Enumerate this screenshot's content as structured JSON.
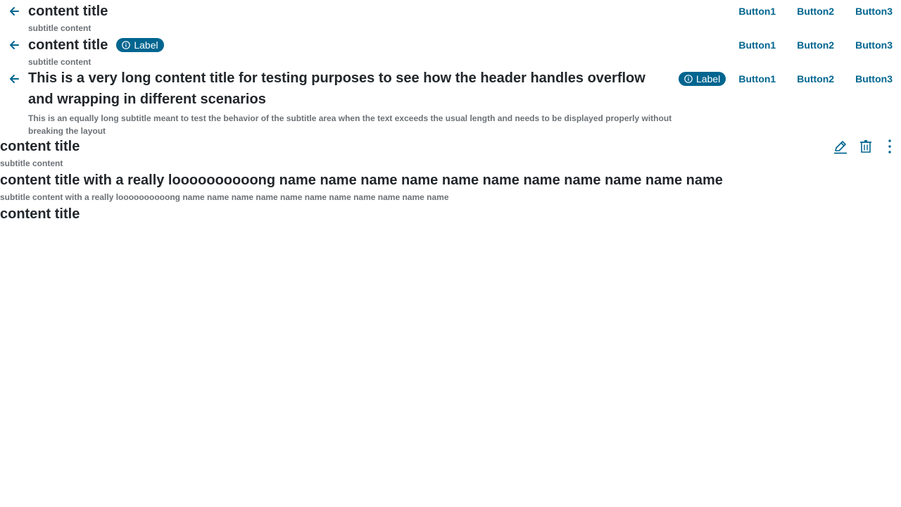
{
  "header1": {
    "title": "content title",
    "subtitle": "subtitle content",
    "buttons": [
      "Button1",
      "Button2",
      "Button3"
    ]
  },
  "header2": {
    "title": "content title",
    "label": "Label",
    "subtitle": "subtitle content",
    "buttons": [
      "Button1",
      "Button2",
      "Button3"
    ]
  },
  "header3": {
    "title": "This is a very long content title for testing purposes to see how the header handles overflow and wrapping in different scenarios",
    "label": "Label",
    "subtitle": "This is an equally long subtitle meant to test the behavior of the subtitle area when the text exceeds the usual length and needs to be displayed properly without breaking the layout",
    "buttons": [
      "Button1",
      "Button2",
      "Button3"
    ]
  },
  "header4": {
    "title": "content title",
    "subtitle": "subtitle content",
    "icons": [
      "edit-icon",
      "trash-icon",
      "more-vertical-icon"
    ]
  },
  "header5": {
    "title": "content title with a really loooooooooong name name name name name name name name name name name",
    "subtitle": "subtitle content with a really loooooooooong name name name name name name name name name name name"
  },
  "header6": {
    "title": "content title"
  },
  "colors": {
    "accent": "#00658f",
    "title": "#22272b",
    "subtitle": "#6c7176"
  }
}
